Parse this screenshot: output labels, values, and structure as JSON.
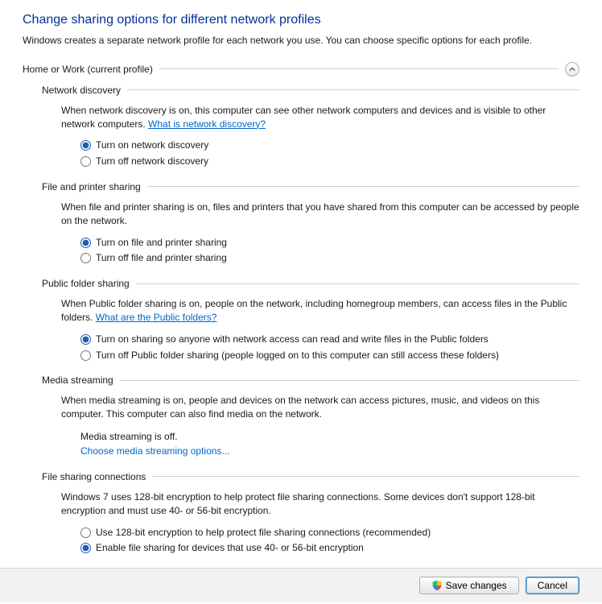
{
  "title": "Change sharing options for different network profiles",
  "description": "Windows creates a separate network profile for each network you use. You can choose specific options for each profile.",
  "profile_header": "Home or Work (current profile)",
  "sections": {
    "discovery": {
      "title": "Network discovery",
      "desc_pre": "When network discovery is on, this computer can see other network computers and devices and is visible to other network computers. ",
      "link": "What is network discovery?",
      "opt_on": "Turn on network discovery",
      "opt_off": "Turn off network discovery"
    },
    "fileprint": {
      "title": "File and printer sharing",
      "desc": "When file and printer sharing is on, files and printers that you have shared from this computer can be accessed by people on the network.",
      "opt_on": "Turn on file and printer sharing",
      "opt_off": "Turn off file and printer sharing"
    },
    "publicfolder": {
      "title": "Public folder sharing",
      "desc_pre": "When Public folder sharing is on, people on the network, including homegroup members, can access files in the Public folders. ",
      "link": "What are the Public folders?",
      "opt_on": "Turn on sharing so anyone with network access can read and write files in the Public folders",
      "opt_off": "Turn off Public folder sharing (people logged on to this computer can still access these folders)"
    },
    "media": {
      "title": "Media streaming",
      "desc": "When media streaming is on, people and devices on the network can access pictures, music, and videos on this computer. This computer can also find media on the network.",
      "status": "Media streaming is off.",
      "action": "Choose media streaming options..."
    },
    "encryption": {
      "title": "File sharing connections",
      "desc": "Windows 7 uses 128-bit encryption to help protect file sharing connections. Some devices don't support 128-bit encryption and must use 40- or 56-bit encryption.",
      "opt_128": "Use 128-bit encryption to help protect file sharing connections (recommended)",
      "opt_4056": "Enable file sharing for devices that use 40- or 56-bit encryption"
    }
  },
  "buttons": {
    "save": "Save changes",
    "cancel": "Cancel"
  }
}
